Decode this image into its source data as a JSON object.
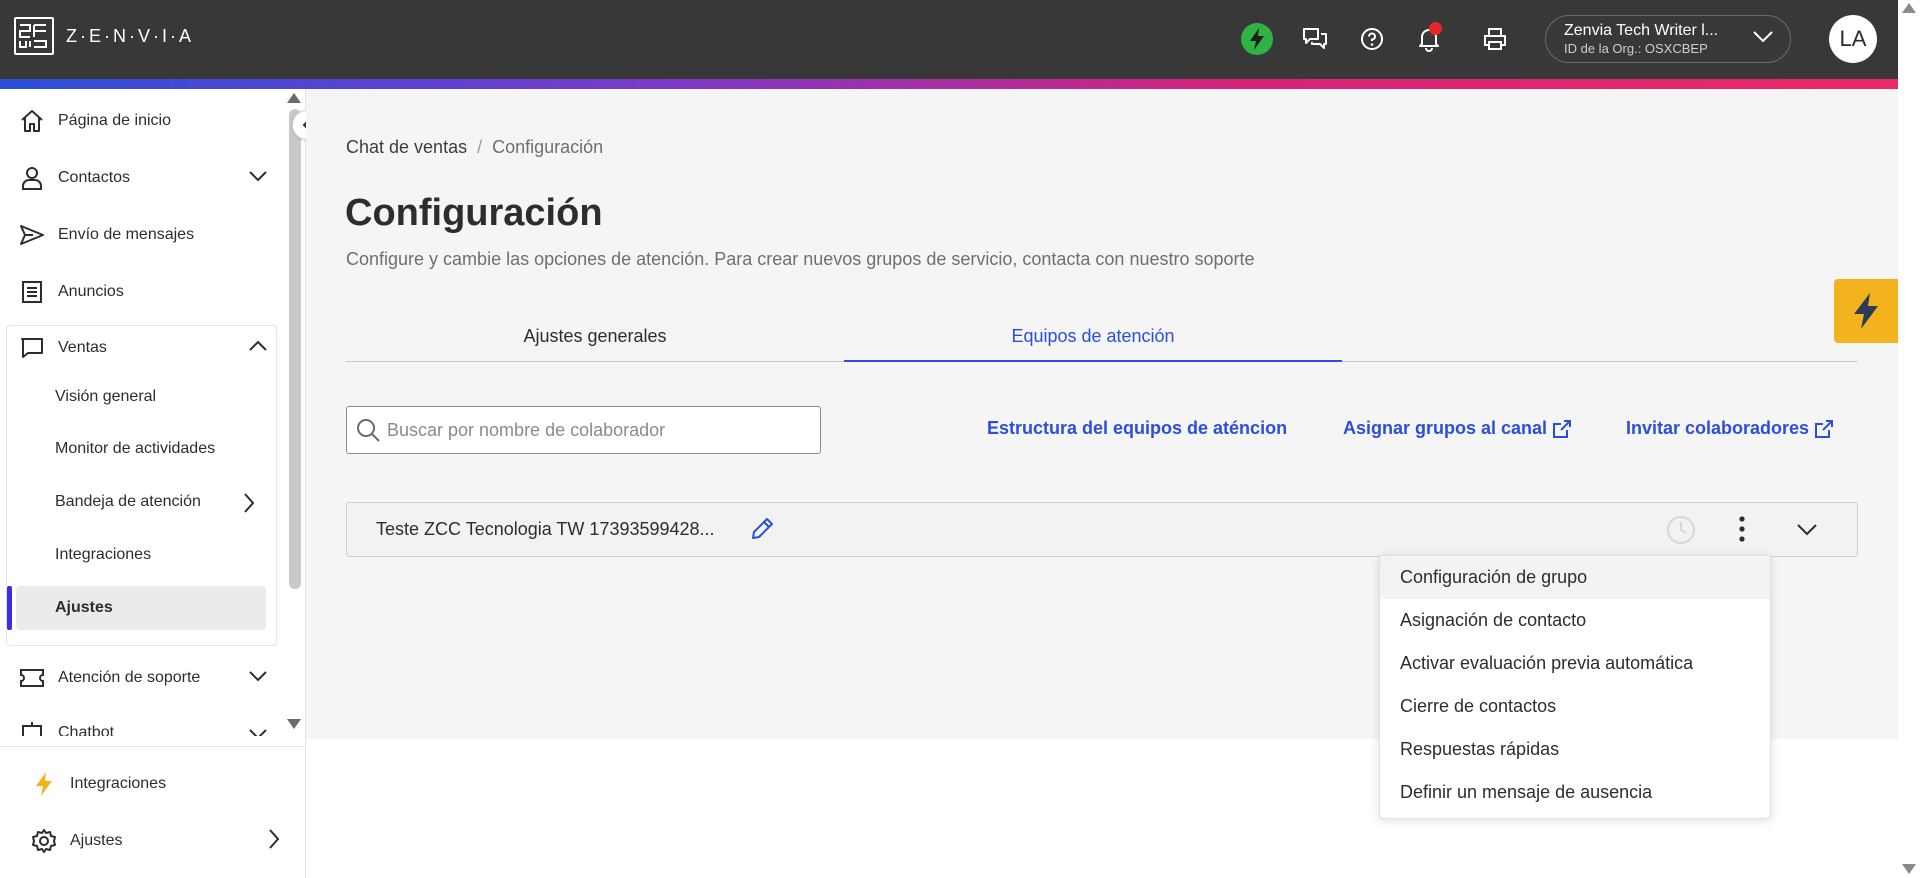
{
  "header": {
    "logo_text": "Z·E·N·V·I·A",
    "org_name": "Zenvia Tech Writer l...",
    "org_id": "ID de la Org.: OSXCBEP",
    "avatar_initials": "LA",
    "icons": [
      "lightning-icon",
      "chat-bubbles-icon",
      "help-icon",
      "bell-icon",
      "printer-icon"
    ],
    "colors": {
      "bar": "#383838",
      "lightning_green": "#2fb344",
      "notification": "#e8262b"
    }
  },
  "sidebar": {
    "items": [
      {
        "label": "Página de inicio",
        "icon": "home-icon"
      },
      {
        "label": "Contactos",
        "icon": "person-icon"
      },
      {
        "label": "Envío de mensajes",
        "icon": "send-icon"
      },
      {
        "label": "Anuncios",
        "icon": "document-icon"
      },
      {
        "label": "Ventas",
        "icon": "chat-icon"
      }
    ],
    "ventas_sub": [
      {
        "label": "Visión general"
      },
      {
        "label": "Monitor de actividades"
      },
      {
        "label": "Bandeja de atención"
      },
      {
        "label": "Integraciones"
      },
      {
        "label": "Ajustes"
      }
    ],
    "after": [
      {
        "label": "Atención de soporte",
        "icon": "ticket-icon"
      },
      {
        "label": "Chatbot",
        "icon": "bot-icon"
      }
    ],
    "bottom": [
      {
        "label": "Integraciones",
        "icon": "lightning-icon"
      },
      {
        "label": "Ajustes",
        "icon": "gear-icon"
      }
    ]
  },
  "main": {
    "breadcrumb": {
      "parent": "Chat de ventas",
      "separator": "/",
      "current": "Configuración"
    },
    "title": "Configuración",
    "description": "Configure y cambie las opciones de atención. Para crear nuevos grupos de servicio, contacta con nuestro soporte",
    "tabs": [
      {
        "label": "Ajustes generales",
        "active": false
      },
      {
        "label": "Equipos de atención",
        "active": true
      }
    ],
    "search": {
      "placeholder": "Buscar por nombre de colaborador"
    },
    "links": {
      "structure": "Estructura del equipos de aténcion",
      "assign": "Asignar grupos al canal",
      "invite": "Invitar colaboradores"
    },
    "group": {
      "name": "Teste ZCC Tecnologia TW 17393599428..."
    },
    "dropdown": [
      "Configuración de grupo",
      "Asignación de contacto",
      "Activar evaluación previa automática",
      "Cierre de contactos",
      "Respuestas rápidas",
      "Definir un mensaje de ausencia"
    ]
  }
}
